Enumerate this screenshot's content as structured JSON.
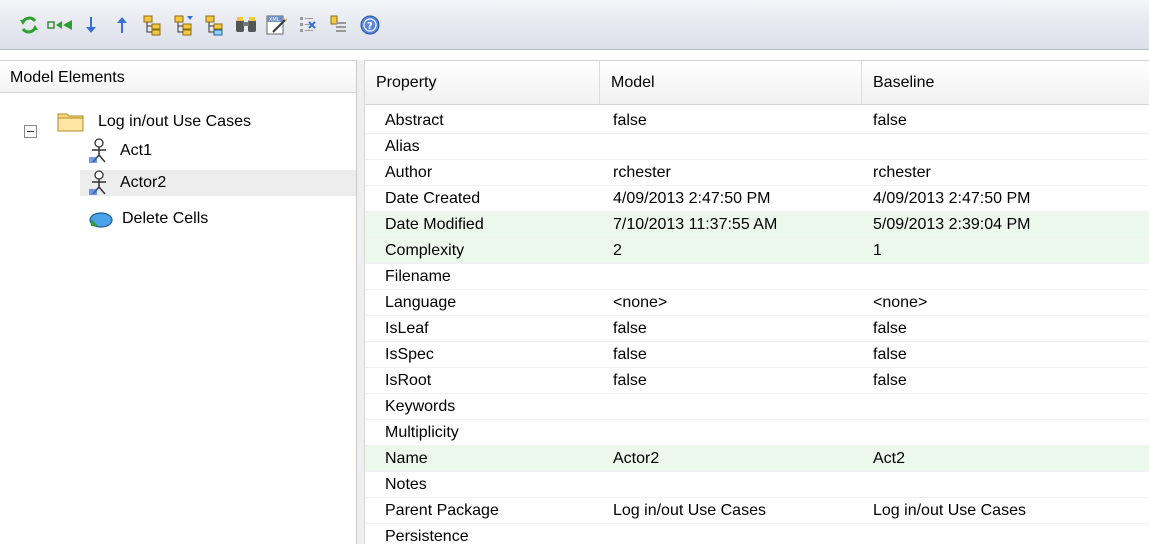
{
  "toolbar": {
    "buttons": [
      {
        "name": "refresh",
        "icon": "refresh-icon",
        "color": "#2ea02e"
      },
      {
        "name": "merge",
        "icon": "merge-arrow-icon",
        "color": "#2ea02e"
      },
      {
        "name": "next-diff",
        "icon": "arrow-down-icon",
        "color": "#3a6fd8"
      },
      {
        "name": "prev-diff",
        "icon": "arrow-up-icon",
        "color": "#3a6fd8"
      },
      {
        "name": "tree-1",
        "icon": "tree-icon"
      },
      {
        "name": "tree-2",
        "icon": "tree-icon"
      },
      {
        "name": "tree-3",
        "icon": "tree-icon"
      },
      {
        "name": "find",
        "icon": "binoculars-icon"
      },
      {
        "name": "xml",
        "icon": "xml-export-icon"
      },
      {
        "name": "options",
        "icon": "checklist-icon"
      },
      {
        "name": "log",
        "icon": "log-icon"
      },
      {
        "name": "help",
        "icon": "help-icon",
        "color": "#3a6fd8"
      }
    ]
  },
  "left_panel": {
    "header": "Model Elements",
    "tree": [
      {
        "label": "Log in/out Use Cases",
        "icon": "folder-icon",
        "level": 0,
        "expanded": true
      },
      {
        "label": "Act1",
        "icon": "actor-icon",
        "level": 1
      },
      {
        "label": "Actor2",
        "icon": "actor-icon",
        "level": 1,
        "selected": true
      },
      {
        "label": "Delete Cells",
        "icon": "use-case-icon",
        "level": 1
      }
    ]
  },
  "grid": {
    "columns": [
      "Property",
      "Model",
      "Baseline"
    ],
    "rows": [
      {
        "property": "Abstract",
        "model": "false",
        "baseline": "false",
        "changed": false
      },
      {
        "property": "Alias",
        "model": "",
        "baseline": "",
        "changed": false
      },
      {
        "property": "Author",
        "model": "rchester",
        "baseline": "rchester",
        "changed": false
      },
      {
        "property": "Date Created",
        "model": "4/09/2013 2:47:50 PM",
        "baseline": "4/09/2013 2:47:50 PM",
        "changed": false
      },
      {
        "property": "Date Modified",
        "model": "7/10/2013 11:37:55 AM",
        "baseline": "5/09/2013 2:39:04 PM",
        "changed": true
      },
      {
        "property": "Complexity",
        "model": "2",
        "baseline": "1",
        "changed": true
      },
      {
        "property": "Filename",
        "model": "",
        "baseline": "",
        "changed": false
      },
      {
        "property": "Language",
        "model": "<none>",
        "baseline": "<none>",
        "changed": false
      },
      {
        "property": "IsLeaf",
        "model": "false",
        "baseline": "false",
        "changed": false
      },
      {
        "property": "IsSpec",
        "model": "false",
        "baseline": "false",
        "changed": false
      },
      {
        "property": "IsRoot",
        "model": "false",
        "baseline": "false",
        "changed": false
      },
      {
        "property": "Keywords",
        "model": "",
        "baseline": "",
        "changed": false
      },
      {
        "property": "Multiplicity",
        "model": "",
        "baseline": "",
        "changed": false
      },
      {
        "property": "Name",
        "model": "Actor2",
        "baseline": "Act2",
        "changed": true
      },
      {
        "property": "Notes",
        "model": "",
        "baseline": "",
        "changed": false
      },
      {
        "property": "Parent Package",
        "model": "Log in/out Use Cases",
        "baseline": "Log in/out Use Cases",
        "changed": false
      },
      {
        "property": "Persistence",
        "model": "",
        "baseline": "",
        "changed": false
      }
    ]
  },
  "colors": {
    "changed_row": "#edf8ed",
    "selected_item": "#ededed"
  }
}
